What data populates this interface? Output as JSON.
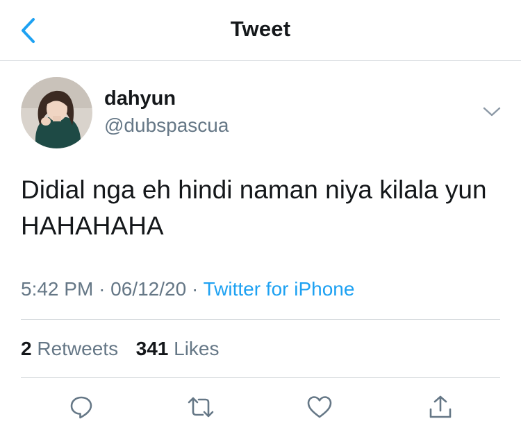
{
  "header": {
    "title": "Tweet",
    "back_icon": "chevron-left-icon"
  },
  "tweet": {
    "author": {
      "display_name": "dahyun",
      "handle": "@dubspascua"
    },
    "text": "Didial nga eh hindi naman niya kilala yun HAHAHAHA",
    "time": "5:42 PM",
    "date": "06/12/20",
    "source": "Twitter for iPhone",
    "stats": {
      "retweets_count": "2",
      "retweets_label": "Retweets",
      "likes_count": "341",
      "likes_label": "Likes"
    }
  },
  "actions": [
    "reply-icon",
    "retweet-icon",
    "like-icon",
    "share-icon"
  ],
  "colors": {
    "accent": "#1da1f2",
    "text": "#14171a",
    "secondary": "#657786",
    "divider": "#d6dadd"
  }
}
